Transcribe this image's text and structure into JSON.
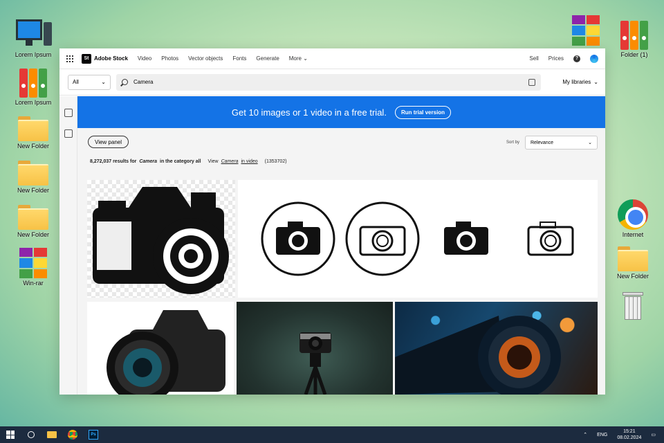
{
  "desktop": {
    "left_icons": [
      "Lorem Ipsum",
      "Lorem Ipsum",
      "New Folder",
      "New Folder",
      "New Folder",
      "Win-rar"
    ],
    "right_icons": [
      "Folder (1)",
      "Internet",
      "New Folder"
    ]
  },
  "browser": {
    "brand_logo": "St",
    "brand": "Adobe Stock",
    "nav": [
      "Video",
      "Photos",
      "Vector objects",
      "Fonts",
      "Generate",
      "More"
    ],
    "right_nav": [
      "Sell",
      "Prices"
    ],
    "help": "?",
    "search": {
      "category": "All",
      "query": "Camera",
      "my_libraries": "My libraries"
    },
    "promo": {
      "text": "Get 10 images or 1 video in a free trial.",
      "button": "Run trial version",
      "color": "#1473e6"
    },
    "view_panel": "View panel",
    "sort_label": "Sort by",
    "sort_value": "Relevance",
    "results": {
      "count_text": "8,272,037 results for",
      "query": "Camera",
      "category_text": "in the category all",
      "view_text": "View",
      "view_query": "Camera",
      "in_video": "in video",
      "video_count": "(1353702)"
    }
  },
  "taskbar": {
    "lang": "ENG",
    "time": "15:21",
    "date": "08.02.2024",
    "ps_label": "Ps"
  }
}
